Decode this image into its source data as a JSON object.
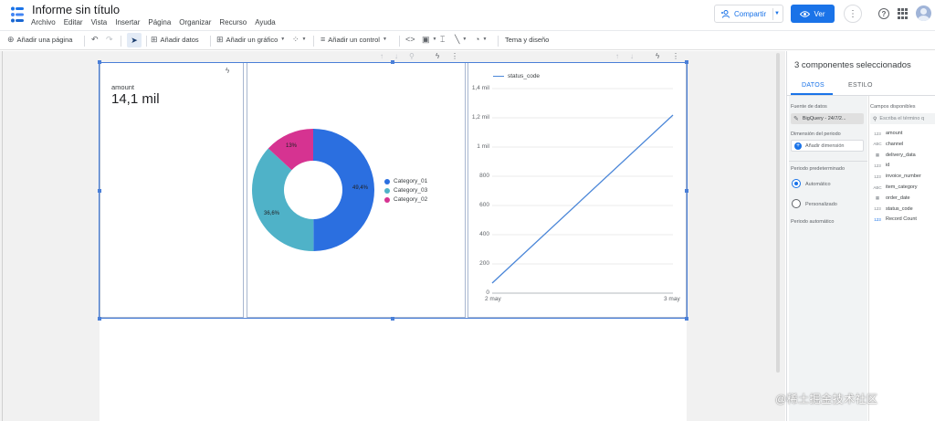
{
  "app": {
    "title": "Informe sin título",
    "menu": [
      "Archivo",
      "Editar",
      "Vista",
      "Insertar",
      "Página",
      "Organizar",
      "Recurso",
      "Ayuda"
    ],
    "share_label": "Compartir",
    "view_label": "Ver"
  },
  "toolbar": {
    "add_page": "Añadir una página",
    "add_data": "Añadir datos",
    "add_chart": "Añadir un gráfico",
    "add_control": "Añadir un control",
    "theme": "Tema y diseño"
  },
  "scorecard": {
    "label": "amount",
    "value": "14,1 mil"
  },
  "donut": {
    "legend": [
      "Category_01",
      "Category_03",
      "Category_02"
    ],
    "labels": [
      "49,4%",
      "36,6%",
      "13%"
    ],
    "colors": [
      "#2b6fe0",
      "#4fb2c8",
      "#d63391"
    ]
  },
  "line_chart": {
    "legend": "status_code",
    "yticks": [
      "1,4 mil",
      "1,2 mil",
      "1 mil",
      "800",
      "600",
      "400",
      "200",
      "0"
    ],
    "xticks": [
      "2 may",
      "3 may"
    ],
    "color": "#4a86d8"
  },
  "panel": {
    "title": "3 componentes seleccionados",
    "tabs": [
      "DATOS",
      "ESTILO"
    ],
    "data_source_label": "Fuente de datos",
    "data_source_value": "BigQuery - 24/7/2...",
    "period_dim_label": "Dimensión del periodo",
    "add_dimension": "Añadir dimensión",
    "default_period_label": "Periodo predeterminado",
    "radio_auto": "Automático",
    "radio_custom": "Personalizado",
    "auto_period": "Periodo automático",
    "available_fields_label": "Campos disponibles",
    "search_placeholder": "Escriba el término q",
    "fields": [
      {
        "type": "123",
        "name": "amount"
      },
      {
        "type": "ABC",
        "name": "channel"
      },
      {
        "type": "cal",
        "name": "delivery_data"
      },
      {
        "type": "123",
        "name": "id"
      },
      {
        "type": "123",
        "name": "invoice_number"
      },
      {
        "type": "ABC",
        "name": "item_category"
      },
      {
        "type": "cal",
        "name": "order_date"
      },
      {
        "type": "123",
        "name": "status_code"
      },
      {
        "type": "123",
        "name": "Record Count"
      }
    ]
  },
  "watermark": "@稀土掘金技术社区"
}
